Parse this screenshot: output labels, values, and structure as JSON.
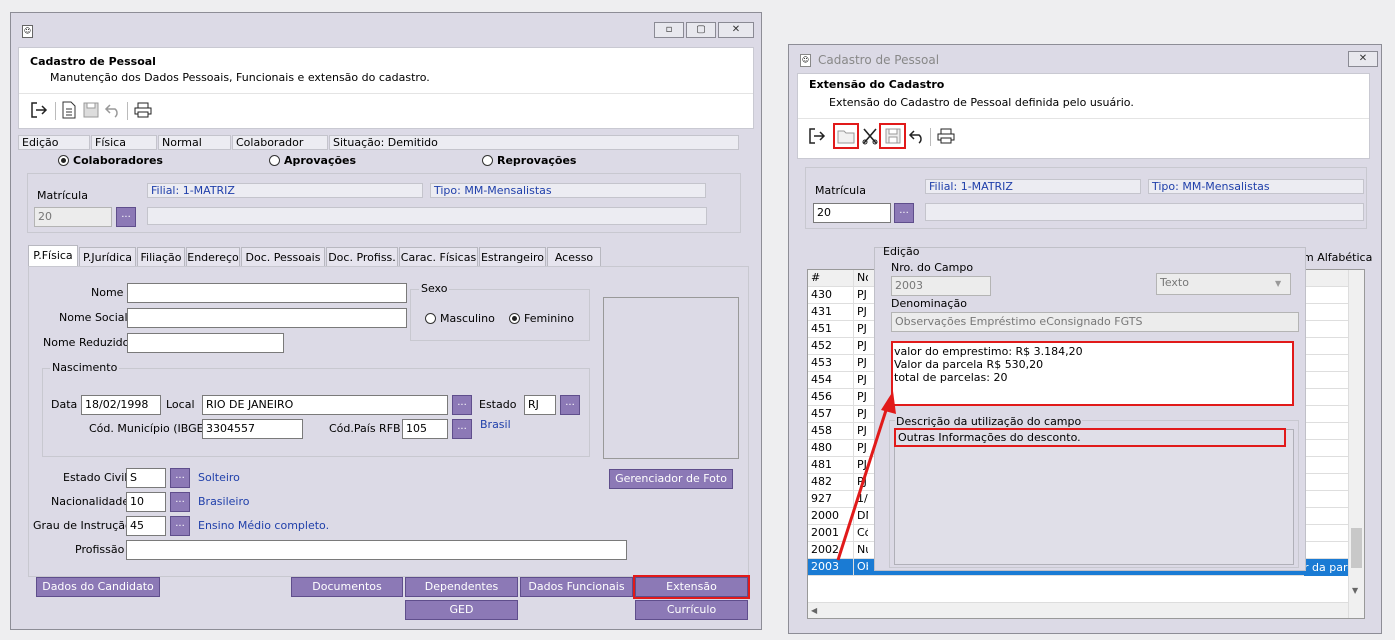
{
  "left_window": {
    "header_title": "Cadastro de Pessoal",
    "header_subtitle": "Manutenção dos Dados Pessoais, Funcionais e extensão do cadastro.",
    "status": [
      "Edição",
      "Física",
      "Normal",
      "Colaborador",
      "Situação: Demitido"
    ],
    "radios": [
      {
        "label": "Colaboradores",
        "checked": true
      },
      {
        "label": "Aprovações",
        "checked": false
      },
      {
        "label": "Reprovações",
        "checked": false
      }
    ],
    "matricula_label": "Matrícula",
    "matricula_value": "20",
    "filial": "Filial: 1-MATRIZ",
    "tipo": "Tipo: MM-Mensalistas",
    "tabs": [
      "P.Física",
      "P.Jurídica",
      "Filiação",
      "Endereço",
      "Doc. Pessoais",
      "Doc. Profiss.",
      "Carac. Físicas",
      "Estrangeiro",
      "Acesso"
    ],
    "form": {
      "nome_label": "Nome",
      "nome_social_label": "Nome Social",
      "nome_reduzido_label": "Nome Reduzido",
      "sexo_label": "Sexo",
      "masculino_label": "Masculino",
      "feminino_label": "Feminino",
      "nascimento_label": "Nascimento",
      "data_label": "Data",
      "data_value": "18/02/1998",
      "local_label": "Local",
      "local_value": "RIO DE JANEIRO",
      "estado_label": "Estado",
      "estado_value": "RJ",
      "municipio_label": "Cód. Município (IBGE)",
      "municipio_value": "3304557",
      "pais_label": "Cód.País RFB",
      "pais_value": "105",
      "pais_desc": "Brasil",
      "estado_civil_label": "Estado Civil",
      "estado_civil_value": "S",
      "estado_civil_desc": "Solteiro",
      "nacionalidade_label": "Nacionalidade",
      "nacionalidade_value": "10",
      "nacionalidade_desc": "Brasileiro",
      "grau_label": "Grau de Instrução",
      "grau_value": "45",
      "grau_desc": "Ensino Médio completo.",
      "profissao_label": "Profissão",
      "foto_button": "Gerenciador de Foto"
    },
    "buttons": {
      "candidato": "Dados do Candidato",
      "documentos": "Documentos",
      "dependentes": "Dependentes",
      "funcionais": "Dados Funcionais",
      "extensao": "Extensão",
      "ged": "GED",
      "curriculo": "Currículo"
    },
    "dots": "..."
  },
  "right_window": {
    "title": "Cadastro de Pessoal",
    "header_title": "Extensão do Cadastro",
    "header_subtitle": "Extensão do Cadastro de Pessoal definida pelo usuário.",
    "matricula_label": "Matrícula",
    "matricula_value": "20",
    "filial": "Filial: 1-MATRIZ",
    "tipo": "Tipo: MM-Mensalistas",
    "grid_header_num": "#",
    "grid_header_name": "No",
    "grid_right_header": "m Alfabética",
    "rows": [
      {
        "num": "430",
        "name": "PJ"
      },
      {
        "num": "431",
        "name": "PJ"
      },
      {
        "num": "451",
        "name": "PJ"
      },
      {
        "num": "452",
        "name": "PJ"
      },
      {
        "num": "453",
        "name": "PJ"
      },
      {
        "num": "454",
        "name": "PJ"
      },
      {
        "num": "456",
        "name": "PJ"
      },
      {
        "num": "457",
        "name": "PJ"
      },
      {
        "num": "458",
        "name": "PJ"
      },
      {
        "num": "480",
        "name": "PJ"
      },
      {
        "num": "481",
        "name": "PJ"
      },
      {
        "num": "482",
        "name": "PJ"
      },
      {
        "num": "927",
        "name": "1/"
      },
      {
        "num": "2000",
        "name": "DN"
      },
      {
        "num": "2001",
        "name": "Có"
      },
      {
        "num": "2002",
        "name": "Nu"
      },
      {
        "num": "2003",
        "name": "Ob"
      }
    ],
    "selected_row_tail": "r da parcel",
    "edit": {
      "group_label": "Edição",
      "nro_label": "Nro. do Campo",
      "nro_value": "2003",
      "tipo_value": "Texto",
      "denominacao_label": "Denominação",
      "denominacao_value": "Observações Empréstimo eConsignado FGTS",
      "value_lines": [
        "valor do emprestimo: R$ 3.184,20",
        "Valor da parcela R$ 530,20",
        "total de parcelas: 20"
      ],
      "descricao_label": "Descrição da utilização do campo",
      "descricao_value": "Outras Informações do desconto."
    },
    "dots": "..."
  },
  "colors": {
    "accent_purple": "#8c79b6",
    "highlight_red": "#e11a1a",
    "selection_blue": "#1a7bd4"
  }
}
